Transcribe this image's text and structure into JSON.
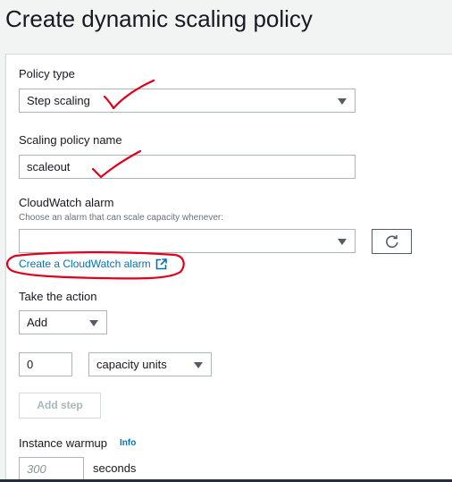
{
  "page": {
    "title": "Create dynamic scaling policy"
  },
  "policy_type": {
    "label": "Policy type",
    "value": "Step scaling"
  },
  "policy_name": {
    "label": "Scaling policy name",
    "value": "scaleout"
  },
  "cloudwatch": {
    "label": "CloudWatch alarm",
    "description": "Choose an alarm that can scale capacity whenever:",
    "value": "",
    "create_link": "Create a CloudWatch alarm"
  },
  "action": {
    "label": "Take the action",
    "operation": "Add",
    "amount": "0",
    "unit": "capacity units",
    "add_step_label": "Add step"
  },
  "warmup": {
    "label": "Instance warmup",
    "info_label": "Info",
    "placeholder": "300",
    "unit": "seconds"
  },
  "colors": {
    "link": "#0073bb",
    "annotation": "#e0001b",
    "background": "#f2f3f3"
  },
  "icons": {
    "dropdown": "caret-down-icon",
    "refresh": "refresh-icon",
    "external_link": "external-link-icon"
  }
}
